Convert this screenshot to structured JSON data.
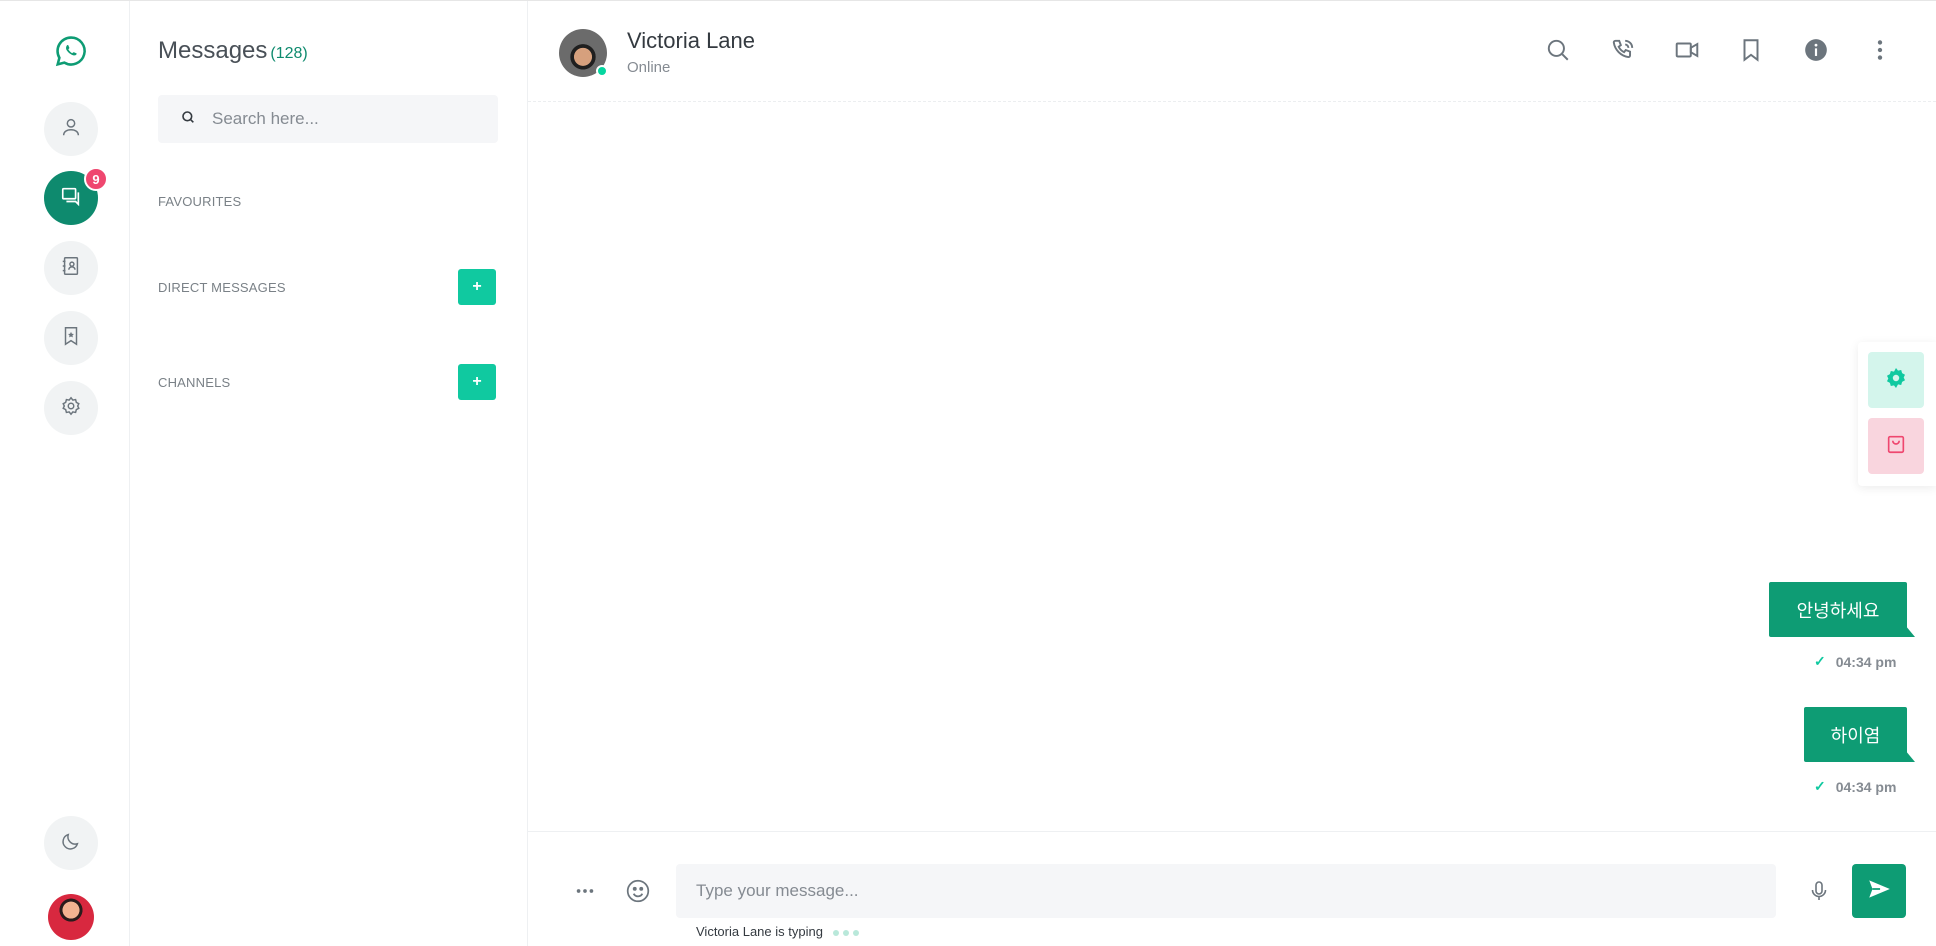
{
  "nav": {
    "logo_icon": "whatsapp-logo",
    "items": [
      {
        "name": "profile",
        "icon": "user-icon"
      },
      {
        "name": "chats",
        "icon": "chat-icon",
        "badge": "9",
        "active": true
      },
      {
        "name": "contacts",
        "icon": "contacts-icon"
      },
      {
        "name": "bookmarks",
        "icon": "bookmark-star-icon"
      },
      {
        "name": "settings",
        "icon": "gear-icon"
      }
    ],
    "theme_icon": "moon-icon"
  },
  "panel": {
    "title": "Messages",
    "count": "(128)",
    "search_placeholder": "Search here...",
    "favourites_label": "FAVOURITES",
    "direct_messages_label": "DIRECT MESSAGES",
    "channels_label": "CHANNELS",
    "add_label": "+"
  },
  "chat": {
    "contact_name": "Victoria Lane",
    "contact_status": "Online",
    "header_icons": [
      "search-icon",
      "phone-call-icon",
      "video-icon",
      "bookmark-icon",
      "info-icon",
      "more-vertical-icon"
    ],
    "messages": [
      {
        "text": "안녕하세요",
        "time": "04:34 pm"
      },
      {
        "text": "하이염",
        "time": "04:34 pm"
      }
    ],
    "composer_placeholder": "Type your message...",
    "typing_text": "Victoria Lane is typing"
  },
  "colors": {
    "accent": "#0e9c74",
    "accent_bright": "#10c9a0",
    "badge": "#ef476f"
  }
}
